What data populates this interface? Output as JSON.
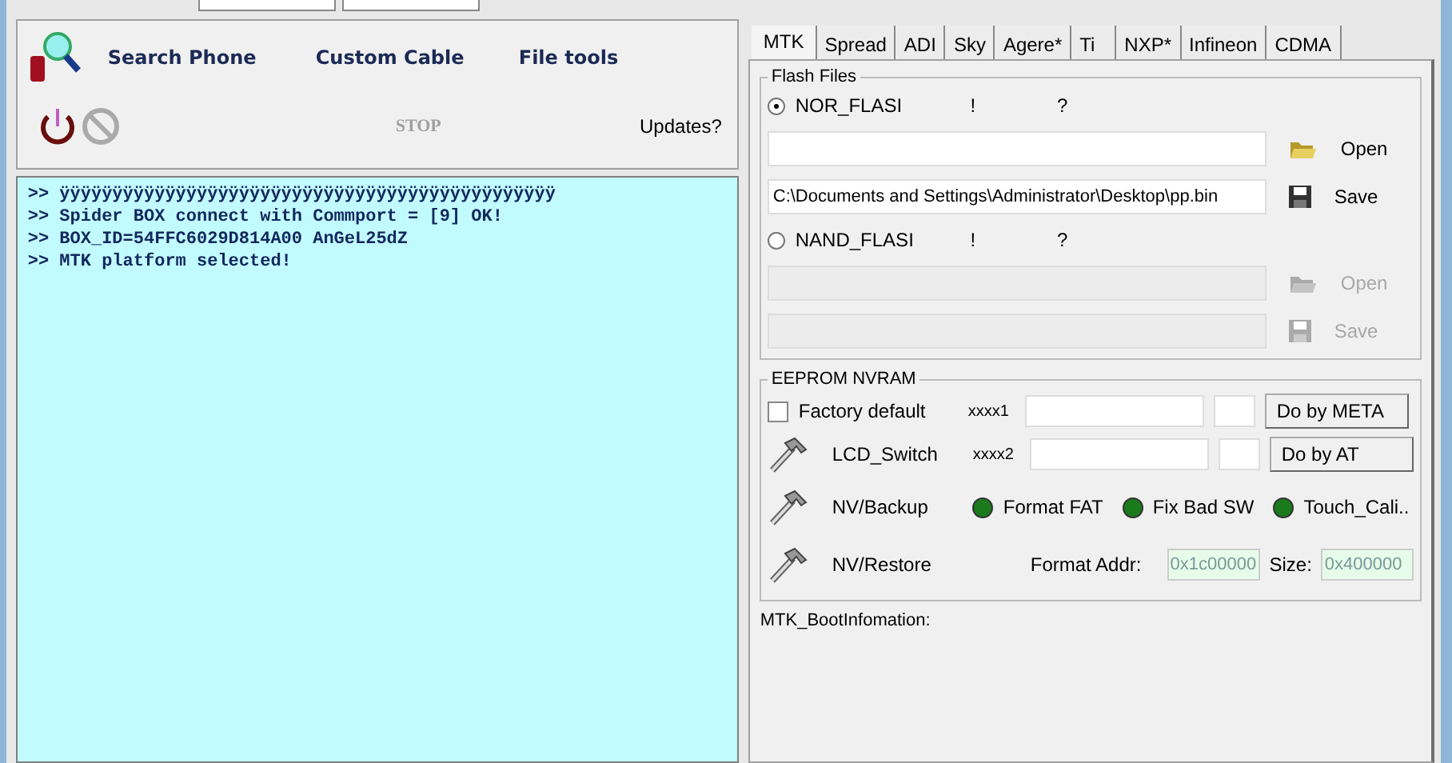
{
  "toolbar": {
    "buttons": [
      {
        "label": "Search Phone",
        "kind": "search"
      },
      {
        "label": "Custom Cable",
        "kind": "text"
      },
      {
        "label": "File tools",
        "kind": "text"
      }
    ],
    "stop": {
      "label": "STOP",
      "disabled": true
    },
    "updates": "Updates?"
  },
  "log": [
    "ÿÿÿÿÿÿÿÿÿÿÿÿÿÿÿÿÿÿÿÿÿÿÿÿÿÿÿÿÿÿÿÿÿÿÿÿÿÿÿÿÿÿÿÿÿÿÿ",
    "Spider BOX connect with Commport = [9] OK!",
    "BOX_ID=54FFC6029D814A00 AnGeL25dZ",
    "MTK platform selected!"
  ],
  "log_prompt": ">>",
  "tabs": [
    {
      "label": "MTK",
      "selected": true
    },
    {
      "label": "Spread",
      "selected": false
    },
    {
      "label": "ADI",
      "selected": false
    },
    {
      "label": "Sky",
      "selected": false
    },
    {
      "label": "Agere*",
      "selected": false
    },
    {
      "label": "Ti",
      "selected": false
    },
    {
      "label": "NXP*",
      "selected": false
    },
    {
      "label": "Infineon",
      "selected": false
    },
    {
      "label": "CDMA",
      "selected": false
    }
  ],
  "flash_files": {
    "title": "Flash Files",
    "options": [
      {
        "label": "NOR_FLASI",
        "selected": true,
        "mark_1": "!",
        "mark_2": "?",
        "open": {
          "label": "Open"
        },
        "save": {
          "value": "C:\\Documents and Settings\\Administrator\\Desktop\\pp.bin",
          "label": "Save"
        }
      },
      {
        "label": "NAND_FLASI",
        "selected": false,
        "mark_1": "!",
        "mark_2": "?",
        "open": {
          "label": "Open"
        },
        "save": {
          "label": "Save"
        }
      }
    ]
  },
  "eeprom": {
    "title": "EEPROM NVRAM",
    "factory_default": {
      "label": "Factory default",
      "checked": false
    },
    "tools": [
      "LCD_Switch",
      "NV/Backup",
      "NV/Restore"
    ],
    "fields": [
      {
        "label": "xxxx1",
        "button": "Do by META"
      },
      {
        "label": "xxxx2",
        "button": "Do by AT"
      }
    ],
    "options": [
      {
        "label": "Format FAT",
        "on": true
      },
      {
        "label": "Fix Bad SW",
        "on": true
      },
      {
        "label": "Touch_Cali..",
        "on": true
      }
    ],
    "format_addr": {
      "label": "Format Addr:",
      "value": "0x1c00000"
    },
    "size": {
      "label": "Size:",
      "value": "0x400000"
    }
  },
  "boot_info": "MTK_BootInfomation:"
}
